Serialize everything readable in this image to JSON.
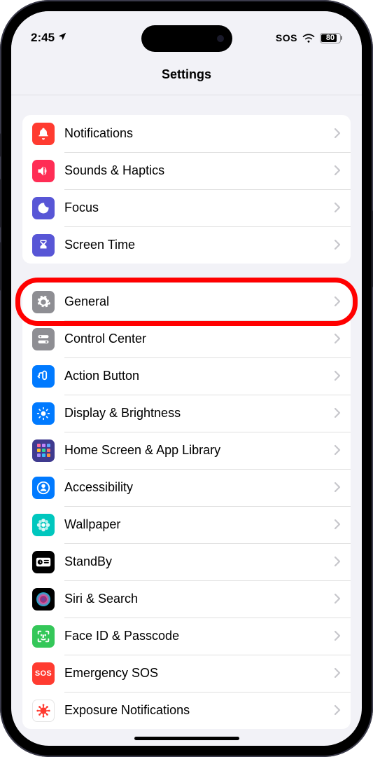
{
  "status": {
    "time": "2:45",
    "sos": "SOS",
    "battery": "80"
  },
  "header": {
    "title": "Settings"
  },
  "groups": [
    {
      "rows": [
        {
          "key": "notifications",
          "label": "Notifications",
          "icon": "bell-icon",
          "bg": "#ff3b30"
        },
        {
          "key": "sounds",
          "label": "Sounds & Haptics",
          "icon": "speaker-icon",
          "bg": "#ff2d55"
        },
        {
          "key": "focus",
          "label": "Focus",
          "icon": "moon-icon",
          "bg": "#5856d6"
        },
        {
          "key": "screentime",
          "label": "Screen Time",
          "icon": "hourglass-icon",
          "bg": "#5856d6"
        }
      ]
    },
    {
      "rows": [
        {
          "key": "general",
          "label": "General",
          "icon": "gear-icon",
          "bg": "#8e8e93",
          "highlighted": true
        },
        {
          "key": "controlcenter",
          "label": "Control Center",
          "icon": "toggles-icon",
          "bg": "#8e8e93"
        },
        {
          "key": "actionbutton",
          "label": "Action Button",
          "icon": "action-icon",
          "bg": "#007aff"
        },
        {
          "key": "display",
          "label": "Display & Brightness",
          "icon": "sun-icon",
          "bg": "#007aff"
        },
        {
          "key": "homescreen",
          "label": "Home Screen & App Library",
          "icon": "grid-icon",
          "bg": "#3f3a8f"
        },
        {
          "key": "accessibility",
          "label": "Accessibility",
          "icon": "person-icon",
          "bg": "#007aff"
        },
        {
          "key": "wallpaper",
          "label": "Wallpaper",
          "icon": "flower-icon",
          "bg": "#00c7be"
        },
        {
          "key": "standby",
          "label": "StandBy",
          "icon": "clock-icon",
          "bg": "#000000"
        },
        {
          "key": "siri",
          "label": "Siri & Search",
          "icon": "siri-icon",
          "bg": "#000000"
        },
        {
          "key": "faceid",
          "label": "Face ID & Passcode",
          "icon": "face-icon",
          "bg": "#34c759"
        },
        {
          "key": "sos",
          "label": "Emergency SOS",
          "icon": "sos-icon",
          "bg": "#ff3b30"
        },
        {
          "key": "exposure",
          "label": "Exposure Notifications",
          "icon": "virus-icon",
          "bg": "#ffffff"
        }
      ]
    }
  ]
}
